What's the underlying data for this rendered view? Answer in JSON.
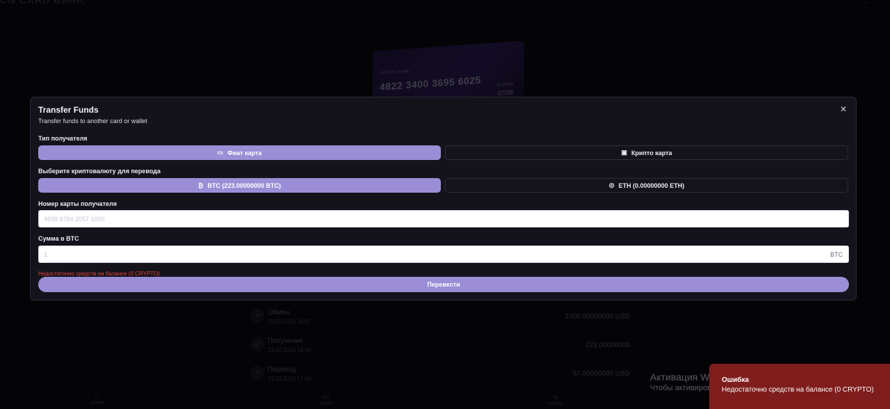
{
  "app": {
    "title": "CG CARD BANK"
  },
  "card": {
    "bank": "CRYPTO BANK",
    "number": "4822 3400 3695 6025",
    "expires_label": "Expires",
    "expires": "07/28"
  },
  "transactions": [
    {
      "name": "Обмен",
      "date": "23.02.2025 18:07",
      "amount": "1000.00000000 USD"
    },
    {
      "name": "Получение",
      "date": "23.02.2025 18:06",
      "amount": "223.00000000"
    },
    {
      "name": "Перевод",
      "date": "23.02.2025 17:50",
      "amount": "57.00000000 USD"
    }
  ],
  "nav": {
    "home": "Home",
    "cards": "Cards",
    "activity": "Activity"
  },
  "windows": {
    "title": "Активация Windows",
    "message": "Чтобы активировать Windows, перейдите в раздел \"Параметры\"."
  },
  "toast": {
    "title": "Ошибка",
    "message": "Недостаточно средств на балансе (0 CRYPTO)"
  },
  "modal": {
    "title": "Transfer Funds",
    "subtitle": "Transfer funds to another card or wallet",
    "recipient_type_label": "Тип получателя",
    "recipient_types": {
      "fiat": "Фиат карта",
      "crypto": "Крипто карта"
    },
    "crypto_label": "Выберите криптовалюту для перевода",
    "crypto_options": {
      "btc": "BTC (223.00000000 BTC)",
      "eth": "ETH (0.00000000 ETH)"
    },
    "card_number_label": "Номер карты получателя",
    "card_number_placeholder": "4699 8784 2057 1000",
    "amount_label": "Сумма в BTC",
    "amount_value": "1",
    "amount_suffix": "BTC",
    "error": "Недостаточно средств на балансе (0 CRYPTO)",
    "submit": "Перевести"
  }
}
